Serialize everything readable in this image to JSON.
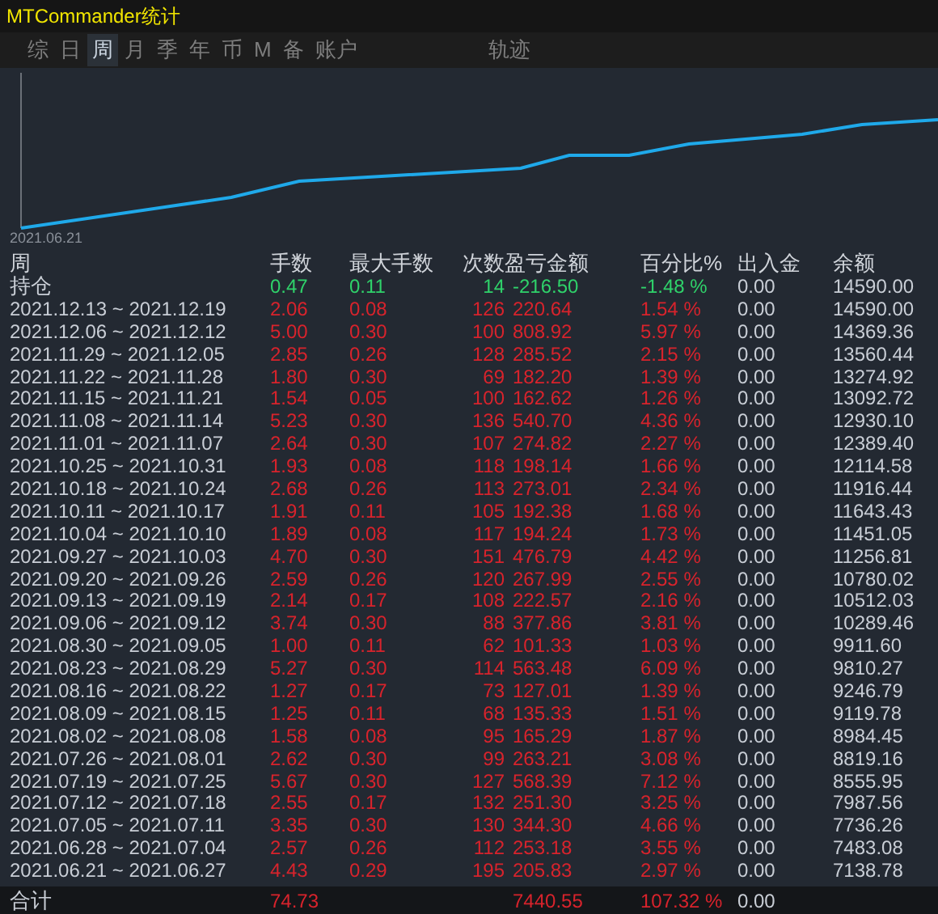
{
  "window": {
    "title": "MTCommander统计"
  },
  "tabs": [
    {
      "label": "综",
      "selected": false
    },
    {
      "label": "日",
      "selected": false
    },
    {
      "label": "周",
      "selected": true
    },
    {
      "label": "月",
      "selected": false
    },
    {
      "label": "季",
      "selected": false
    },
    {
      "label": "年",
      "selected": false
    },
    {
      "label": "币",
      "selected": false
    },
    {
      "label": "M",
      "selected": false
    },
    {
      "label": "备",
      "selected": false
    },
    {
      "label": "账户",
      "selected": false
    }
  ],
  "trace_tab": {
    "label": "轨迹",
    "selected": false
  },
  "chart": {
    "start_label": "2021.06.21"
  },
  "table": {
    "columns": [
      "周",
      "手数",
      "最大手数",
      "次数",
      "盈亏金额",
      "百分比%",
      "出入金",
      "余额"
    ],
    "rows": [
      {
        "kind": "open",
        "cells": [
          "持仓",
          "0.47",
          "0.11",
          "14",
          "-216.50",
          "-1.48 %",
          "0.00",
          "14590.00"
        ]
      },
      {
        "kind": "week",
        "cells": [
          "2021.12.13 ~ 2021.12.19",
          "2.06",
          "0.08",
          "126",
          "220.64",
          "1.54 %",
          "0.00",
          "14590.00"
        ]
      },
      {
        "kind": "week",
        "cells": [
          "2021.12.06 ~ 2021.12.12",
          "5.00",
          "0.30",
          "100",
          "808.92",
          "5.97 %",
          "0.00",
          "14369.36"
        ]
      },
      {
        "kind": "week",
        "cells": [
          "2021.11.29 ~ 2021.12.05",
          "2.85",
          "0.26",
          "128",
          "285.52",
          "2.15 %",
          "0.00",
          "13560.44"
        ]
      },
      {
        "kind": "week",
        "cells": [
          "2021.11.22 ~ 2021.11.28",
          "1.80",
          "0.30",
          "69",
          "182.20",
          "1.39 %",
          "0.00",
          "13274.92"
        ]
      },
      {
        "kind": "week",
        "cells": [
          "2021.11.15 ~ 2021.11.21",
          "1.54",
          "0.05",
          "100",
          "162.62",
          "1.26 %",
          "0.00",
          "13092.72"
        ]
      },
      {
        "kind": "week",
        "cells": [
          "2021.11.08 ~ 2021.11.14",
          "5.23",
          "0.30",
          "136",
          "540.70",
          "4.36 %",
          "0.00",
          "12930.10"
        ]
      },
      {
        "kind": "week",
        "cells": [
          "2021.11.01 ~ 2021.11.07",
          "2.64",
          "0.30",
          "107",
          "274.82",
          "2.27 %",
          "0.00",
          "12389.40"
        ]
      },
      {
        "kind": "week",
        "cells": [
          "2021.10.25 ~ 2021.10.31",
          "1.93",
          "0.08",
          "118",
          "198.14",
          "1.66 %",
          "0.00",
          "12114.58"
        ]
      },
      {
        "kind": "week",
        "cells": [
          "2021.10.18 ~ 2021.10.24",
          "2.68",
          "0.26",
          "113",
          "273.01",
          "2.34 %",
          "0.00",
          "11916.44"
        ]
      },
      {
        "kind": "week",
        "cells": [
          "2021.10.11 ~ 2021.10.17",
          "1.91",
          "0.11",
          "105",
          "192.38",
          "1.68 %",
          "0.00",
          "11643.43"
        ]
      },
      {
        "kind": "week",
        "cells": [
          "2021.10.04 ~ 2021.10.10",
          "1.89",
          "0.08",
          "117",
          "194.24",
          "1.73 %",
          "0.00",
          "11451.05"
        ]
      },
      {
        "kind": "week",
        "cells": [
          "2021.09.27 ~ 2021.10.03",
          "4.70",
          "0.30",
          "151",
          "476.79",
          "4.42 %",
          "0.00",
          "11256.81"
        ]
      },
      {
        "kind": "week",
        "cells": [
          "2021.09.20 ~ 2021.09.26",
          "2.59",
          "0.26",
          "120",
          "267.99",
          "2.55 %",
          "0.00",
          "10780.02"
        ]
      },
      {
        "kind": "week",
        "cells": [
          "2021.09.13 ~ 2021.09.19",
          "2.14",
          "0.17",
          "108",
          "222.57",
          "2.16 %",
          "0.00",
          "10512.03"
        ]
      },
      {
        "kind": "week",
        "cells": [
          "2021.09.06 ~ 2021.09.12",
          "3.74",
          "0.30",
          "88",
          "377.86",
          "3.81 %",
          "0.00",
          "10289.46"
        ]
      },
      {
        "kind": "week",
        "cells": [
          "2021.08.30 ~ 2021.09.05",
          "1.00",
          "0.11",
          "62",
          "101.33",
          "1.03 %",
          "0.00",
          "9911.60"
        ]
      },
      {
        "kind": "week",
        "cells": [
          "2021.08.23 ~ 2021.08.29",
          "5.27",
          "0.30",
          "114",
          "563.48",
          "6.09 %",
          "0.00",
          "9810.27"
        ]
      },
      {
        "kind": "week",
        "cells": [
          "2021.08.16 ~ 2021.08.22",
          "1.27",
          "0.17",
          "73",
          "127.01",
          "1.39 %",
          "0.00",
          "9246.79"
        ]
      },
      {
        "kind": "week",
        "cells": [
          "2021.08.09 ~ 2021.08.15",
          "1.25",
          "0.11",
          "68",
          "135.33",
          "1.51 %",
          "0.00",
          "9119.78"
        ]
      },
      {
        "kind": "week",
        "cells": [
          "2021.08.02 ~ 2021.08.08",
          "1.58",
          "0.08",
          "95",
          "165.29",
          "1.87 %",
          "0.00",
          "8984.45"
        ]
      },
      {
        "kind": "week",
        "cells": [
          "2021.07.26 ~ 2021.08.01",
          "2.62",
          "0.30",
          "99",
          "263.21",
          "3.08 %",
          "0.00",
          "8819.16"
        ]
      },
      {
        "kind": "week",
        "cells": [
          "2021.07.19 ~ 2021.07.25",
          "5.67",
          "0.30",
          "127",
          "568.39",
          "7.12 %",
          "0.00",
          "8555.95"
        ]
      },
      {
        "kind": "week",
        "cells": [
          "2021.07.12 ~ 2021.07.18",
          "2.55",
          "0.17",
          "132",
          "251.30",
          "3.25 %",
          "0.00",
          "7987.56"
        ]
      },
      {
        "kind": "week",
        "cells": [
          "2021.07.05 ~ 2021.07.11",
          "3.35",
          "0.30",
          "130",
          "344.30",
          "4.66 %",
          "0.00",
          "7736.26"
        ]
      },
      {
        "kind": "week",
        "cells": [
          "2021.06.28 ~ 2021.07.04",
          "2.57",
          "0.26",
          "112",
          "253.18",
          "3.55 %",
          "0.00",
          "7483.08"
        ]
      },
      {
        "kind": "week",
        "cells": [
          "2021.06.21 ~ 2021.06.27",
          "4.43",
          "0.29",
          "195",
          "205.83",
          "2.97 %",
          "0.00",
          "7138.78"
        ]
      }
    ],
    "total": {
      "label": "合计",
      "lots": "74.73",
      "pnl": "7440.55",
      "percent": "107.32 %",
      "deposit": "0.00"
    }
  }
}
